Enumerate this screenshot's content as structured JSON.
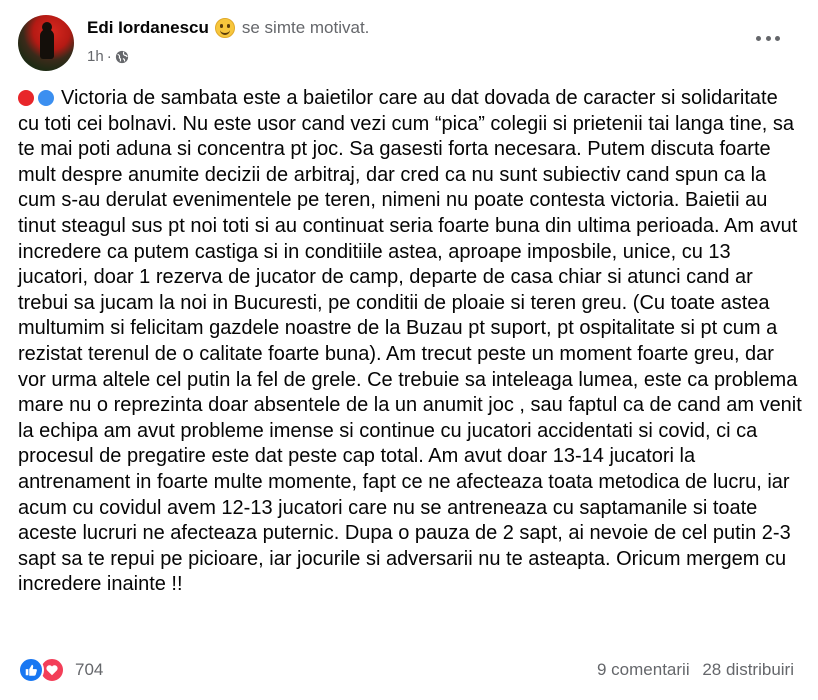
{
  "post": {
    "author": "Edi Iordanescu",
    "feeling_icon": "smiling-face-emoji",
    "feeling": "se simte motivat.",
    "time": "1h",
    "separator": "·",
    "audience_icon": "globe-icon",
    "text": "Victoria de sambata este a  baietilor care au dat dovada de caracter si solidaritate cu toti cei bolnavi. Nu este usor cand vezi cum “pica” colegii si prietenii tai langa tine, sa te mai poti aduna si concentra pt joc. Sa gasesti forta necesara. Putem discuta foarte mult despre anumite decizii de arbitraj, dar cred ca nu sunt subiectiv cand spun ca la cum s-au derulat evenimentele pe teren, nimeni nu poate contesta victoria. Baietii au tinut steagul sus pt noi toti si au continuat seria foarte buna din ultima perioada. Am avut incredere ca putem castiga si in conditiile astea, aproape imposbile, unice, cu 13 jucatori, doar 1 rezerva de jucator de camp, departe de casa chiar si atunci cand ar trebui sa jucam la noi in Bucuresti, pe conditii de ploaie si teren greu. (Cu toate astea multumim si felicitam gazdele noastre de la Buzau pt suport, pt ospitalitate si pt cum a rezistat terenul de o calitate foarte buna). Am trecut peste un moment foarte greu, dar vor urma altele cel putin la fel de grele. Ce trebuie sa inteleaga lumea, este ca problema mare nu o reprezinta doar absentele de la un anumit joc , sau faptul ca de cand am venit la echipa am avut probleme imense si continue cu jucatori accidentati si covid, ci ca procesul de pregatire este dat peste cap total. Am avut doar 13-14 jucatori la antrenament in foarte multe momente, fapt ce ne afecteaza toata metodica de lucru, iar acum cu covidul avem 12-13 jucatori care nu se antreneaza cu saptamanile si toate aceste lucruri ne afecteaza puternic. Dupa o pauza de 2 sapt, ai nevoie de cel putin 2-3 sapt sa te repui pe picioare, iar jocurile si adversarii nu te asteapta. Oricum mergem cu incredere inainte !!",
    "leading_icons": [
      "red-circle-icon",
      "blue-circle-icon"
    ],
    "colors": {
      "red": "#e8262a",
      "blue": "#3b8ff0",
      "like": "#1877f2",
      "love": "#f33e58",
      "secondary_text": "#65676b"
    }
  },
  "footer": {
    "reaction_icons": [
      "like-reaction-icon",
      "love-reaction-icon"
    ],
    "reaction_count": "704",
    "comments": "9 comentarii",
    "shares": "28 distribuiri"
  }
}
